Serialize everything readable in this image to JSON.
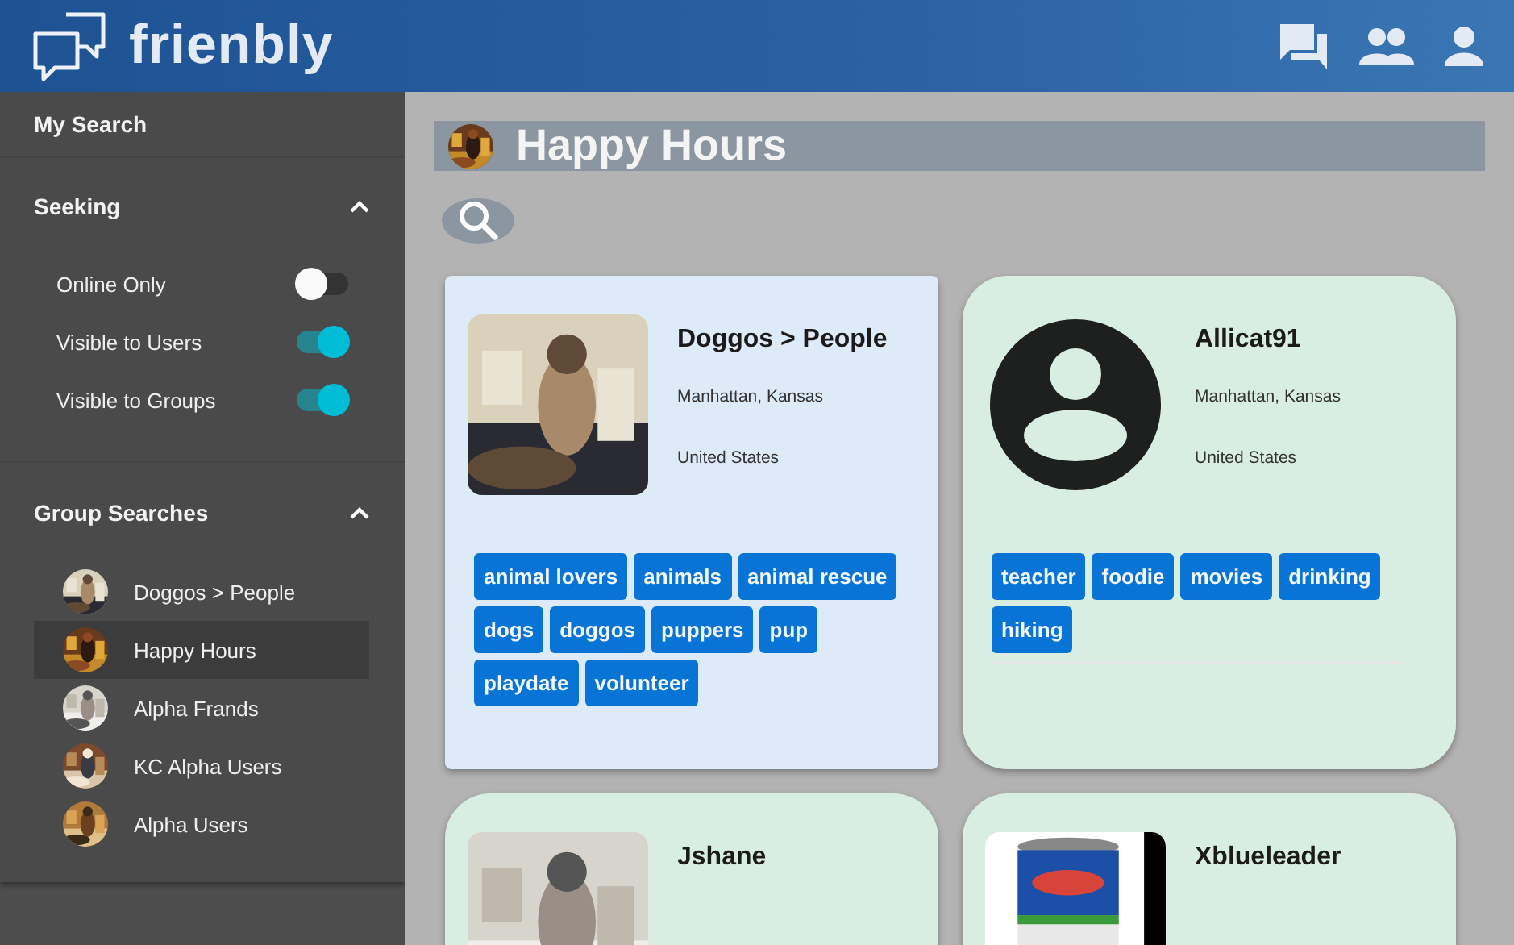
{
  "app": {
    "name": "frienbly"
  },
  "sidebar": {
    "my_search": "My Search",
    "seeking": {
      "title": "Seeking",
      "expanded": true,
      "toggles": [
        {
          "label": "Online Only",
          "on": false
        },
        {
          "label": "Visible to Users",
          "on": true
        },
        {
          "label": "Visible to Groups",
          "on": true
        }
      ]
    },
    "group_searches": {
      "title": "Group Searches",
      "expanded": true,
      "items": [
        {
          "label": "Doggos > People",
          "selected": false
        },
        {
          "label": "Happy Hours",
          "selected": true
        },
        {
          "label": "Alpha Frands",
          "selected": false
        },
        {
          "label": "KC Alpha Users",
          "selected": false
        },
        {
          "label": "Alpha Users",
          "selected": false
        }
      ]
    }
  },
  "page": {
    "title": "Happy Hours"
  },
  "cards": [
    {
      "kind": "group",
      "name": "Doggos > People",
      "city": "Manhattan, Kansas",
      "country": "United States",
      "tags": [
        "animal lovers",
        "animals",
        "animal rescue",
        "dogs",
        "doggos",
        "puppers",
        "pup",
        "playdate",
        "volunteer"
      ]
    },
    {
      "kind": "user",
      "name": "Allicat91",
      "city": "Manhattan, Kansas",
      "country": "United States",
      "avatar": {
        "kind": "placeholder"
      },
      "tags": [
        "teacher",
        "foodie",
        "movies",
        "drinking",
        "hiking"
      ]
    },
    {
      "kind": "user",
      "name": "Jshane"
    },
    {
      "kind": "user",
      "name": "Xblueleader"
    }
  ]
}
